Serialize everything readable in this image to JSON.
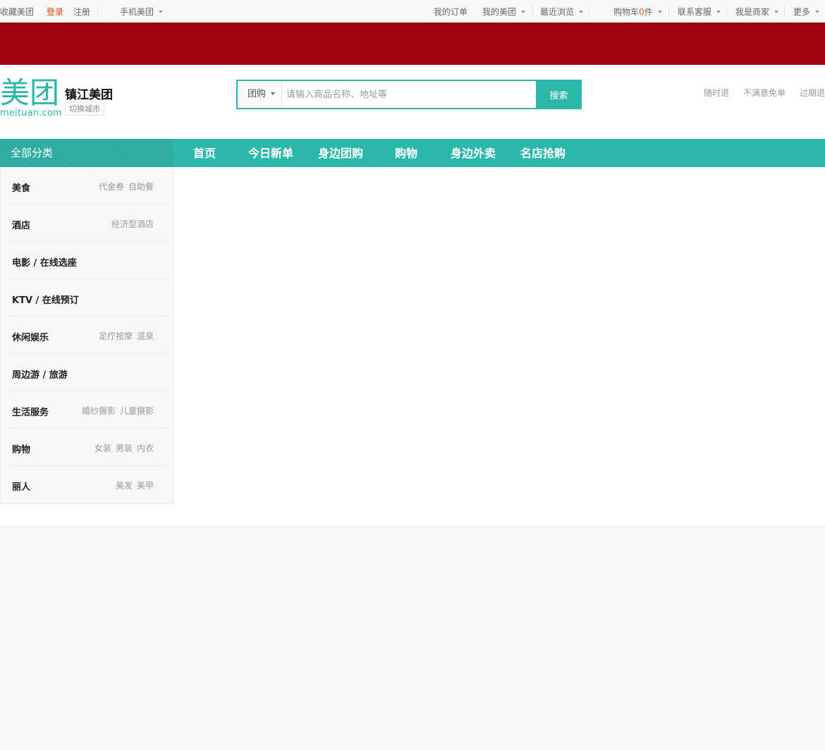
{
  "topbar": {
    "favorite": "收藏美团",
    "login": "登录",
    "register": "注册",
    "mobile": "手机美团",
    "my_orders": "我的订单",
    "my_meituan": "我的美团",
    "recent": "最近浏览",
    "cart_prefix": "购物车",
    "cart_count": "0",
    "cart_suffix": "件",
    "support": "联系客服",
    "merchant": "我是商家",
    "more": "更多"
  },
  "header": {
    "logo_text": "美团",
    "logo_domain": "meituan.com",
    "city": "镇江美团",
    "switch_city": "切换城市",
    "search_type": "团购",
    "search_placeholder": "请输入商品名称、地址等",
    "search_button": "搜索",
    "promises": [
      "随时退",
      "不满意免单",
      "过期退"
    ]
  },
  "nav": {
    "all_categories": "全部分类",
    "links": [
      "首页",
      "今日新单",
      "身边团购",
      "购物",
      "身边外卖",
      "名店抢购"
    ]
  },
  "categories": [
    {
      "name": "美食",
      "subs": [
        "代金券",
        "自助餐"
      ]
    },
    {
      "name": "酒店",
      "subs": [
        "经济型酒店"
      ]
    },
    {
      "name": "电影 / 在线选座",
      "subs": []
    },
    {
      "name": "KTV / 在线预订",
      "subs": []
    },
    {
      "name": "休闲娱乐",
      "subs": [
        "足疗按摩",
        "温泉"
      ]
    },
    {
      "name": "周边游 / 旅游",
      "subs": []
    },
    {
      "name": "生活服务",
      "subs": [
        "婚纱摄影",
        "儿童摄影"
      ]
    },
    {
      "name": "购物",
      "subs": [
        "女装",
        "男装",
        "内衣"
      ]
    },
    {
      "name": "丽人",
      "subs": [
        "美发",
        "美甲"
      ]
    }
  ],
  "colors": {
    "brand": "#2bb8aa",
    "banner": "#a00510",
    "login": "#d34a0f",
    "cart_count": "#f76120"
  }
}
